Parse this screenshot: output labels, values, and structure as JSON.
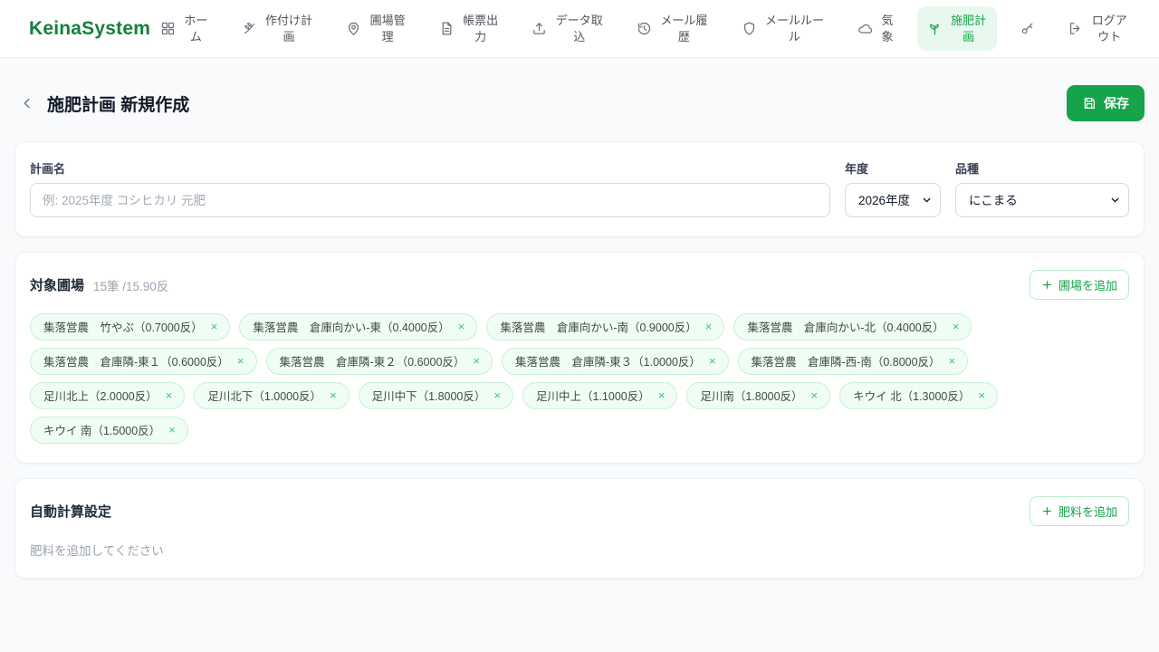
{
  "brand": "KeinaSystem",
  "colors": {
    "brand_green": "#15803d",
    "accent_green": "#16a34a",
    "active_nav_bg": "#e8f8ee",
    "tag_bg": "#f0fdf4",
    "tag_border": "#c9f0d6"
  },
  "nav": {
    "items": [
      {
        "label": "ホーム",
        "icon": "grid-icon",
        "active": false
      },
      {
        "label": "作付け計画",
        "icon": "wheat-icon",
        "active": false
      },
      {
        "label": "圃場管理",
        "icon": "map-pin-icon",
        "active": false
      },
      {
        "label": "帳票出力",
        "icon": "document-icon",
        "active": false
      },
      {
        "label": "データ取込",
        "icon": "upload-icon",
        "active": false
      },
      {
        "label": "メール履歴",
        "icon": "history-icon",
        "active": false
      },
      {
        "label": "メールルール",
        "icon": "shield-icon",
        "active": false
      },
      {
        "label": "気象",
        "icon": "cloud-icon",
        "active": false
      },
      {
        "label": "施肥計画",
        "icon": "sprout-icon",
        "active": true
      },
      {
        "label": "",
        "icon": "key-icon",
        "active": false
      },
      {
        "label": "ログアウト",
        "icon": "logout-icon",
        "active": false
      }
    ]
  },
  "header": {
    "title": "施肥計画 新規作成",
    "save_label": "保存"
  },
  "form": {
    "plan_name": {
      "label": "計画名",
      "placeholder": "例: 2025年度 コシヒカリ 元肥",
      "value": ""
    },
    "year": {
      "label": "年度",
      "value": "2026年度"
    },
    "variety": {
      "label": "品種",
      "value": "にこまる"
    }
  },
  "fields_section": {
    "title": "対象圃場",
    "summary": "15筆 /15.90反",
    "add_button": "圃場を追加",
    "remove_symbol": "×",
    "tags": [
      "集落営農　竹やぶ（0.7000反）",
      "集落営農　倉庫向かい-東（0.4000反）",
      "集落営農　倉庫向かい-南（0.9000反）",
      "集落営農　倉庫向かい-北（0.4000反）",
      "集落営農　倉庫隣-東１（0.6000反）",
      "集落営農　倉庫隣-東２（0.6000反）",
      "集落営農　倉庫隣-東３（1.0000反）",
      "集落営農　倉庫隣-西-南（0.8000反）",
      "足川北上（2.0000反）",
      "足川北下（1.0000反）",
      "足川中下（1.8000反）",
      "足川中上（1.1000反）",
      "足川南（1.8000反）",
      "キウイ 北（1.3000反）",
      "キウイ 南（1.5000反）"
    ]
  },
  "auto_calc": {
    "title": "自動計算設定",
    "add_button": "肥料を追加",
    "empty_text": "肥料を追加してください"
  }
}
